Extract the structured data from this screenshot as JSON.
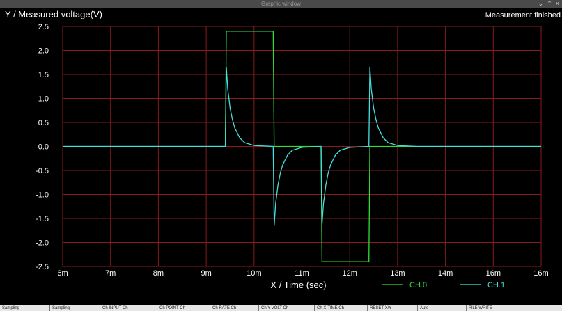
{
  "window": {
    "title": "Graphic window",
    "controls": [
      "⌄",
      "⌃",
      "×"
    ]
  },
  "status_text": "Measurement finished",
  "toolbar": {
    "buttons": [
      "Sampling",
      "Sampling",
      "Ch INPUT Ch",
      "Ch POINT Ch",
      "Ch RATE Ch",
      "Ch Y-VOLT Ch",
      "Ch X-TIME Ch",
      "RESET X/Y",
      "Auto",
      "FILE WRITE"
    ]
  },
  "colors": {
    "background": "#000000",
    "grid": "#8b1a1a",
    "ch0": "#33dd33",
    "ch1": "#44e0e0",
    "text": "#ffffff"
  },
  "chart_data": {
    "type": "line",
    "ylabel": "Y / Measured voltage(V)",
    "xlabel": "X / Time (sec)",
    "ylim": [
      -2.5,
      2.5
    ],
    "yticks": [
      "2.5",
      "2.0",
      "1.5",
      "1.0",
      "0.5",
      "0.0",
      "-0.5",
      "-1.0",
      "-1.5",
      "-2.0",
      "-2.5"
    ],
    "xticks": [
      "6m",
      "7m",
      "8m",
      "9m",
      "10m",
      "11m",
      "12m",
      "13m",
      "14m",
      "16m",
      "16m"
    ],
    "grid": true,
    "legend": "bottom-right",
    "series": [
      {
        "name": "CH.0",
        "points": [
          [
            6.0,
            0
          ],
          [
            9.4,
            0
          ],
          [
            9.42,
            2.4
          ],
          [
            10.4,
            2.4
          ],
          [
            10.42,
            0
          ],
          [
            11.4,
            0
          ],
          [
            11.42,
            -2.4
          ],
          [
            12.4,
            -2.4
          ],
          [
            12.42,
            0
          ],
          [
            16.0,
            0
          ]
        ]
      },
      {
        "name": "CH.1",
        "points": [
          [
            6.0,
            0
          ],
          [
            9.4,
            0
          ],
          [
            9.42,
            1.65
          ],
          [
            9.45,
            1.2
          ],
          [
            9.5,
            0.8
          ],
          [
            9.55,
            0.55
          ],
          [
            9.6,
            0.38
          ],
          [
            9.7,
            0.18
          ],
          [
            9.8,
            0.08
          ],
          [
            10.0,
            0.02
          ],
          [
            10.4,
            0
          ],
          [
            10.42,
            -1.65
          ],
          [
            10.45,
            -1.2
          ],
          [
            10.5,
            -0.8
          ],
          [
            10.55,
            -0.55
          ],
          [
            10.6,
            -0.38
          ],
          [
            10.7,
            -0.18
          ],
          [
            10.8,
            -0.08
          ],
          [
            11.0,
            -0.02
          ],
          [
            11.4,
            0
          ],
          [
            11.42,
            -1.62
          ],
          [
            11.45,
            -1.2
          ],
          [
            11.5,
            -0.8
          ],
          [
            11.55,
            -0.55
          ],
          [
            11.6,
            -0.38
          ],
          [
            11.7,
            -0.18
          ],
          [
            11.8,
            -0.08
          ],
          [
            12.0,
            -0.02
          ],
          [
            12.4,
            0
          ],
          [
            12.42,
            1.65
          ],
          [
            12.45,
            1.2
          ],
          [
            12.5,
            0.8
          ],
          [
            12.55,
            0.55
          ],
          [
            12.6,
            0.38
          ],
          [
            12.7,
            0.18
          ],
          [
            12.8,
            0.08
          ],
          [
            13.0,
            0.02
          ],
          [
            13.4,
            0
          ],
          [
            16.0,
            0
          ]
        ]
      }
    ]
  }
}
